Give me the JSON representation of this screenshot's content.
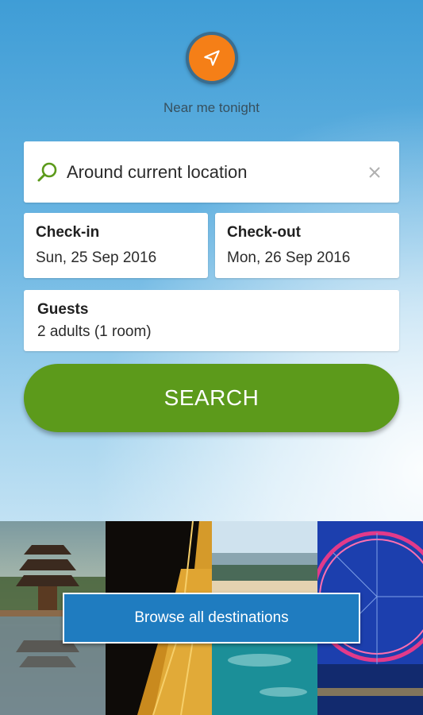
{
  "near_me": {
    "label": "Near me tonight",
    "icon": "navigation-arrow-icon"
  },
  "search": {
    "location_text": "Around current location",
    "search_icon": "search-icon",
    "clear_icon": "close-icon"
  },
  "check_in": {
    "title": "Check-in",
    "value": "Sun, 25 Sep 2016"
  },
  "check_out": {
    "title": "Check-out",
    "value": "Mon, 26 Sep 2016"
  },
  "guests": {
    "title": "Guests",
    "value": "2 adults (1 room)"
  },
  "search_button": {
    "label": "SEARCH"
  },
  "destinations": {
    "browse_label": "Browse all destinations",
    "tiles": [
      "bali-temple-image",
      "eiffel-tower-image",
      "beach-coast-image",
      "london-eye-image"
    ]
  },
  "colors": {
    "accent_orange": "#f57f17",
    "search_green": "#5c9a1b",
    "browse_blue": "#1f7cc0"
  }
}
